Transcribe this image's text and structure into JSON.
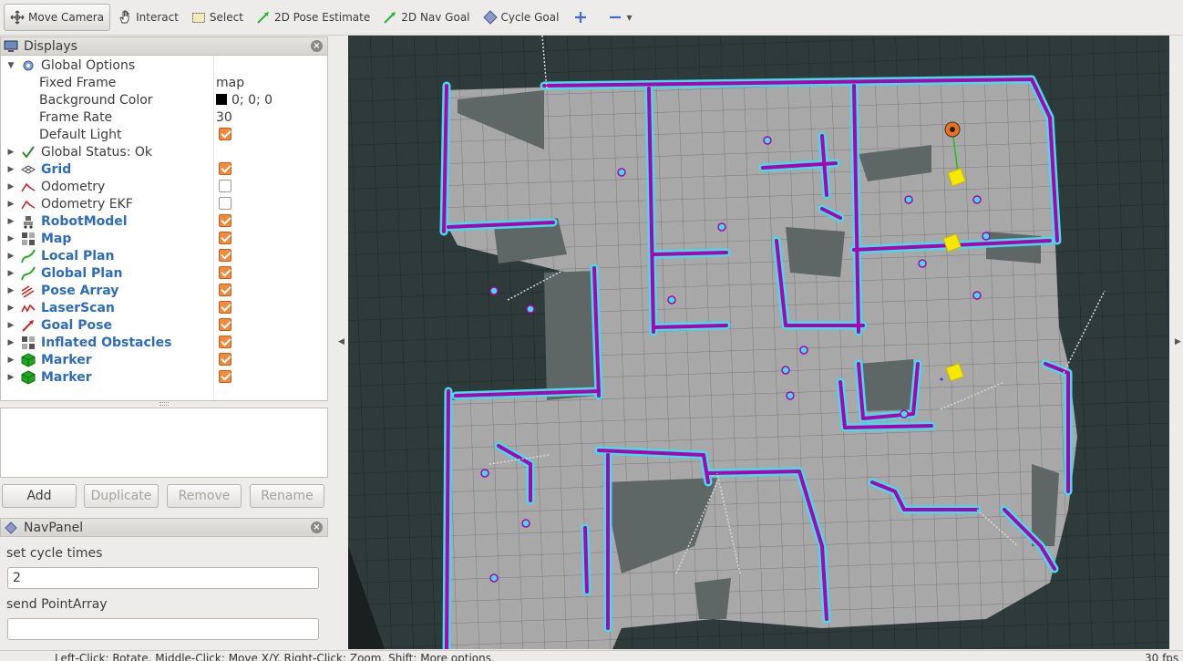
{
  "toolbar": {
    "move_camera": "Move Camera",
    "interact": "Interact",
    "select": "Select",
    "pose_estimate": "2D Pose Estimate",
    "nav_goal": "2D Nav Goal",
    "cycle_goal": "Cycle Goal"
  },
  "displays": {
    "title": "Displays",
    "global_options": {
      "label": "Global Options",
      "fixed_frame_label": "Fixed Frame",
      "fixed_frame_value": "map",
      "background_color_label": "Background Color",
      "background_color_value": "0; 0; 0",
      "frame_rate_label": "Frame Rate",
      "frame_rate_value": "30",
      "default_light_label": "Default Light",
      "default_light_checked": true
    },
    "global_status": "Global Status: Ok",
    "items": [
      {
        "label": "Grid",
        "icon": "grid-icon",
        "checked": true
      },
      {
        "label": "Odometry",
        "icon": "odometry-icon",
        "checked": false
      },
      {
        "label": "Odometry EKF",
        "icon": "odometry-icon",
        "checked": false
      },
      {
        "label": "RobotModel",
        "icon": "robot-model-icon",
        "checked": true
      },
      {
        "label": "Map",
        "icon": "map-icon",
        "checked": true
      },
      {
        "label": "Local Plan",
        "icon": "path-icon",
        "checked": true
      },
      {
        "label": "Global Plan",
        "icon": "path-icon",
        "checked": true
      },
      {
        "label": "Pose Array",
        "icon": "pose-array-icon",
        "checked": true
      },
      {
        "label": "LaserScan",
        "icon": "laser-scan-icon",
        "checked": true
      },
      {
        "label": "Goal Pose",
        "icon": "pose-icon",
        "checked": true
      },
      {
        "label": "Inflated Obstacles",
        "icon": "map-icon",
        "checked": true
      },
      {
        "label": "Marker",
        "icon": "marker-icon",
        "checked": true
      },
      {
        "label": "Marker",
        "icon": "marker-icon",
        "checked": true
      }
    ]
  },
  "buttons": {
    "add": "Add",
    "duplicate": "Duplicate",
    "remove": "Remove",
    "rename": "Rename"
  },
  "navpanel": {
    "title": "NavPanel",
    "cycle_label": "set cycle times",
    "cycle_value": "2",
    "point_array_label": "send PointArray",
    "point_array_value": ""
  },
  "status_bar": {
    "hint": "Left-Click: Rotate. Middle-Click: Move X/Y. Right-Click: Zoom. Shift: More options.",
    "fps": "30 fps"
  },
  "colors": {
    "viewport_bg": "#2f3a3b",
    "map_free": "#a8a8a8",
    "cost_cyan": "#3de0e8",
    "cost_magenta": "#b000b0",
    "marker_yellow": "#f8e800",
    "checkbox_orange": "#f08a3c",
    "blue_label": "#2c6cc0"
  }
}
